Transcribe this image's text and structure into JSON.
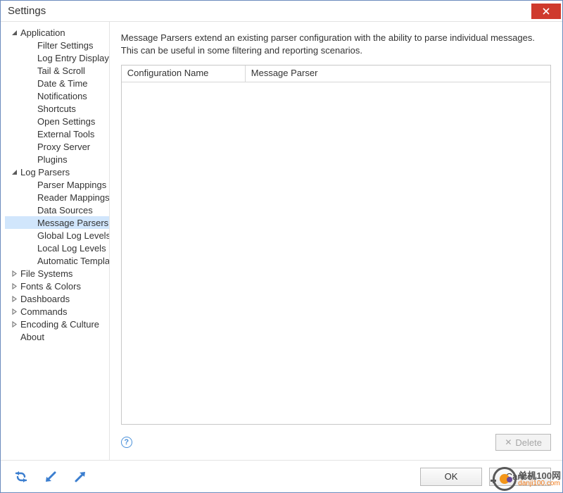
{
  "window": {
    "title": "Settings"
  },
  "tree": [
    {
      "label": "Application",
      "expanded": true,
      "children": [
        {
          "label": "Filter Settings"
        },
        {
          "label": "Log Entry Display"
        },
        {
          "label": "Tail & Scroll"
        },
        {
          "label": "Date & Time"
        },
        {
          "label": "Notifications"
        },
        {
          "label": "Shortcuts"
        },
        {
          "label": "Open Settings"
        },
        {
          "label": "External Tools"
        },
        {
          "label": "Proxy Server"
        },
        {
          "label": "Plugins"
        }
      ]
    },
    {
      "label": "Log Parsers",
      "expanded": true,
      "children": [
        {
          "label": "Parser Mappings"
        },
        {
          "label": "Reader Mappings"
        },
        {
          "label": "Data Sources"
        },
        {
          "label": "Message Parsers",
          "selected": true
        },
        {
          "label": "Global Log Levels"
        },
        {
          "label": "Local Log Levels"
        },
        {
          "label": "Automatic Templates"
        }
      ]
    },
    {
      "label": "File Systems",
      "expanded": false
    },
    {
      "label": "Fonts & Colors",
      "expanded": false
    },
    {
      "label": "Dashboards",
      "expanded": false
    },
    {
      "label": "Commands",
      "expanded": false
    },
    {
      "label": "Encoding & Culture",
      "expanded": false
    },
    {
      "label": "About",
      "leaf": true
    }
  ],
  "content": {
    "description": "Message Parsers extend an existing parser configuration with the ability to parse individual messages.  This can be useful in some filtering and reporting scenarios.",
    "columns": {
      "name": "Configuration Name",
      "parser": "Message Parser"
    },
    "rows": []
  },
  "buttons": {
    "delete": "Delete",
    "ok": "OK",
    "cancel": "Cancel"
  },
  "watermark": {
    "cn": "单机100网",
    "url": "danji100.com"
  }
}
